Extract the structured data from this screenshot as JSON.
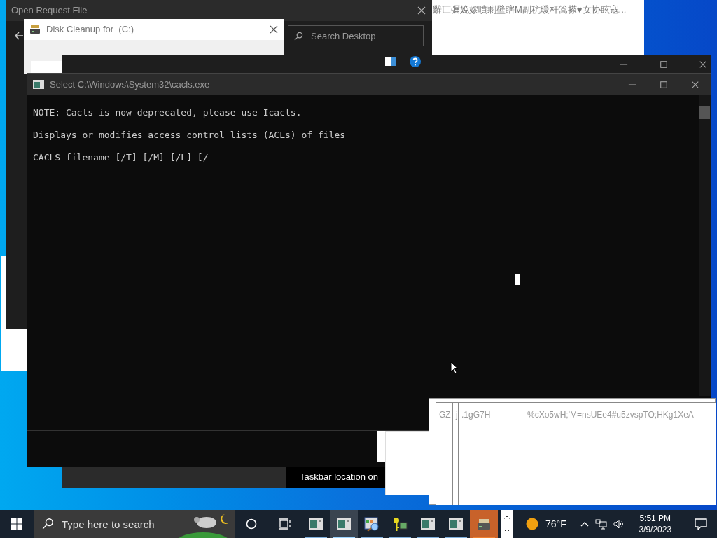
{
  "background_window": {
    "text": "辭匸彌娩嫪噴剩壁瞎M副秔暖杆篙搽♥女协眩寇..."
  },
  "open_request_file": {
    "title": "Open Request File",
    "search": {
      "placeholder": "Search Desktop"
    }
  },
  "disk_cleanup": {
    "title": "Disk Cleanup for  (C:)"
  },
  "cmd_window": {
    "title": "Select C:\\Windows\\System32\\cacls.exe",
    "lines": [
      "NOTE: Cacls is now deprecated, please use Icacls.",
      "Displays or modifies access control lists (ACLs) of files",
      "CACLS filename [/T] [/M] [/L] [/"
    ]
  },
  "settings_snippet": {
    "text": "Taskbar location on"
  },
  "stacked_windows": [
    {
      "text": "GZ"
    },
    {
      "text": "j"
    },
    {
      "text": ".1gG7H"
    },
    {
      "text": "%cXo5wH;'M=nsUEe4#u5zvspTO;HKg1XeA"
    }
  ],
  "taskbar": {
    "search": {
      "placeholder": "Type here to search"
    },
    "apps": [
      {
        "kind": "window",
        "selected": false,
        "flashing": false
      },
      {
        "kind": "window",
        "selected": true,
        "flashing": false
      },
      {
        "kind": "control-panel",
        "selected": false,
        "flashing": false
      },
      {
        "kind": "key",
        "selected": false,
        "flashing": false
      },
      {
        "kind": "window",
        "selected": false,
        "flashing": false
      },
      {
        "kind": "window",
        "selected": false,
        "flashing": false
      },
      {
        "kind": "drive",
        "selected": false,
        "flashing": true
      }
    ],
    "weather": "76°F",
    "time": "5:51 PM",
    "date": "3/9/2023"
  }
}
